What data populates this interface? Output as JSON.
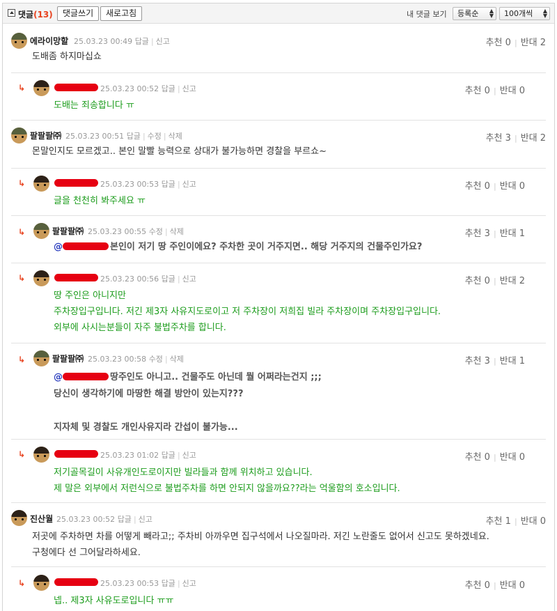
{
  "header": {
    "title": "댓글",
    "count": "(13)",
    "write_button": "댓글쓰기",
    "refresh_button": "새로고침",
    "my_comments": "내 댓글 보기",
    "sort_select": "등록순",
    "page_size_select": "100개씩"
  },
  "labels": {
    "reply": "답글",
    "report": "신고",
    "edit": "수정",
    "delete": "삭제",
    "recommend": "추천",
    "oppose": "반대"
  },
  "comments": [
    {
      "author": "에라이망할",
      "date": "25.03.23 00:49",
      "up": "0",
      "down": "2",
      "lines": [
        "도배좀 하지마십쇼"
      ]
    },
    {
      "author": "",
      "date": "25.03.23 00:52",
      "up": "0",
      "down": "0",
      "lines": [
        "도배는 죄송합니다 ㅠ"
      ]
    },
    {
      "author": "팔팔팔㈜",
      "date": "25.03.23 00:51",
      "up": "3",
      "down": "2",
      "lines": [
        "몬말인지도 모르겠고.. 본인 말빨 능력으로 상대가 불가능하면 경찰을 부르쇼~"
      ]
    },
    {
      "author": "",
      "date": "25.03.23 00:53",
      "up": "0",
      "down": "0",
      "lines": [
        "글을 천천히 봐주세요 ㅠ"
      ]
    },
    {
      "author": "팔팔팔㈜",
      "date": "25.03.23 00:55",
      "up": "3",
      "down": "1",
      "mention_prefix": "@",
      "lines": [
        "본인이 저기 땅 주인이에요? 주차한 곳이 거주지면.. 해당 거주지의 건물주인가요?"
      ]
    },
    {
      "author": "",
      "date": "25.03.23 00:56",
      "up": "0",
      "down": "2",
      "lines": [
        "땅 주인은 아니지만",
        "주차장입구입니다. 저긴 제3자 사유지도로이고 저 주차장이 저희집 빌라 주차장이며 주차장입구입니다.",
        "외부에 사시는분들이 자주 불법주차를 합니다."
      ]
    },
    {
      "author": "팔팔팔㈜",
      "date": "25.03.23 00:58",
      "up": "3",
      "down": "1",
      "mention_prefix": "@",
      "lines": [
        "땅주인도 아니고.. 건물주도 아닌데 뭘 어쩌라는건지 ;;;",
        "당신이 생각하기에 마땅한 해결 방안이 있는지???",
        "",
        "지자체 및 경찰도 개인사유지라 간섭이 불가능..."
      ]
    },
    {
      "author": "",
      "date": "25.03.23 01:02",
      "up": "0",
      "down": "0",
      "lines": [
        "저기골목길이 사유개인도로이지만 빌라들과 함께 위치하고 있습니다.",
        "제 말은 외부에서 저런식으로 불법주차를 하면 안되지 않을까요??라는 억울함의 호소입니다."
      ]
    },
    {
      "author": "진산월",
      "date": "25.03.23 00:52",
      "up": "1",
      "down": "0",
      "lines": [
        "저곳에 주차하면 차를 어떻게 빼라고;; 주차비 아까우면 집구석에서 나오질마라. 저긴 노란줄도 없어서 신고도 못하겠네요.",
        "구청에다 선 그어달라하세요."
      ]
    },
    {
      "author": "",
      "date": "25.03.23 00:53",
      "up": "0",
      "down": "0",
      "lines": [
        "넵.. 제3자 사유도로입니다 ㅠㅠ"
      ]
    }
  ]
}
